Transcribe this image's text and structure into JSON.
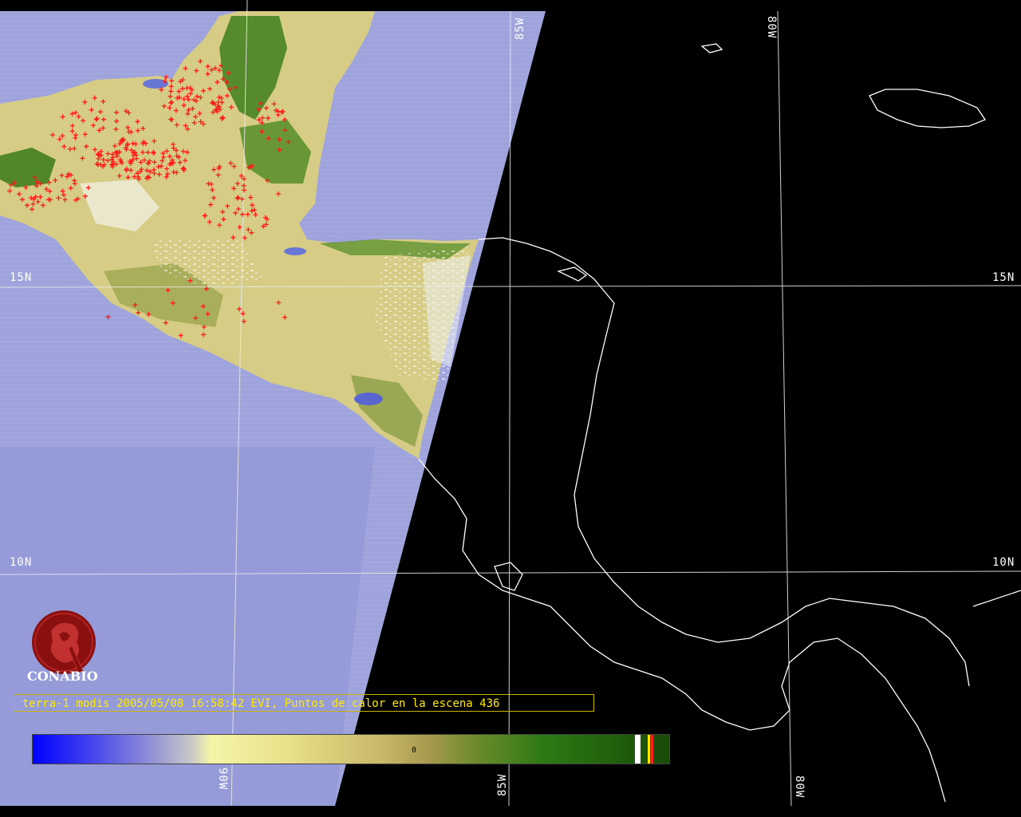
{
  "caption": "terra-1 modis 2005/05/08 16:58:42 EVI, Puntos de calor en la escena 436",
  "logo_text": "CONABIO",
  "grid_labels": {
    "lat_15_left": "15N",
    "lat_15_right": "15N",
    "lat_10_left": "10N",
    "lat_10_right": "10N",
    "lon_85_top": "85W",
    "lon_80_top": "80W",
    "lon_90_bottom": "90W",
    "lon_85_bottom": "85W",
    "lon_80_bottom": "80W"
  },
  "colorbar": {
    "zero_label": "0"
  },
  "colors": {
    "ocean_day": "#9ea3dc",
    "land_dry": "#d8cf8a",
    "land_green": "#3f7f1c",
    "hotspot": "#ff1a1a",
    "night": "#000000",
    "coastline": "#ffffff",
    "caption_text": "#ffea00"
  },
  "hotspot_count": 436
}
